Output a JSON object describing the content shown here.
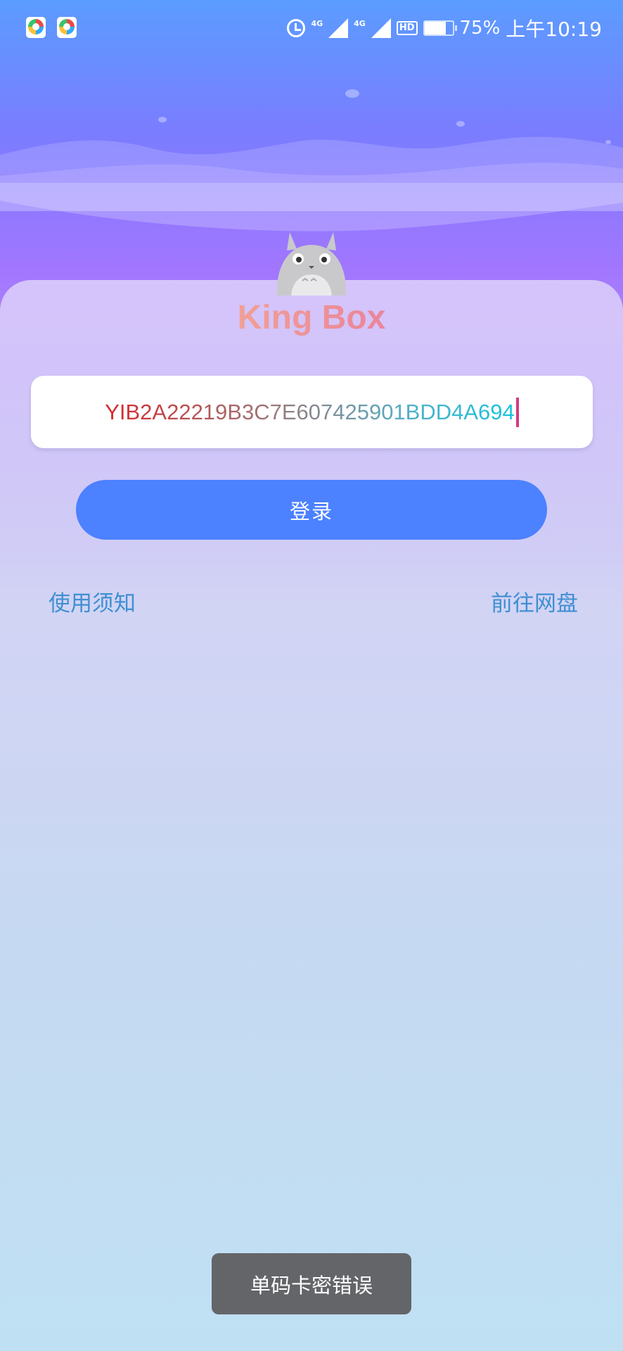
{
  "status_bar": {
    "network_label_1": "4G",
    "network_label_2": "4G",
    "hd_label": "HD",
    "battery_percent": "75%",
    "battery_level": 0.75,
    "time": "上午10:19"
  },
  "app": {
    "title": "King Box",
    "title_gradient": [
      "#f2aa94",
      "#e97a9c"
    ]
  },
  "login_form": {
    "code_value": "YIB2A22219B3C7E607425901BDD4A694",
    "login_label": "登录",
    "accent_color": "#4c81ff"
  },
  "links": {
    "notice_label": "使用须知",
    "netdisk_label": "前往网盘"
  },
  "toast": {
    "message": "单码卡密错误"
  }
}
